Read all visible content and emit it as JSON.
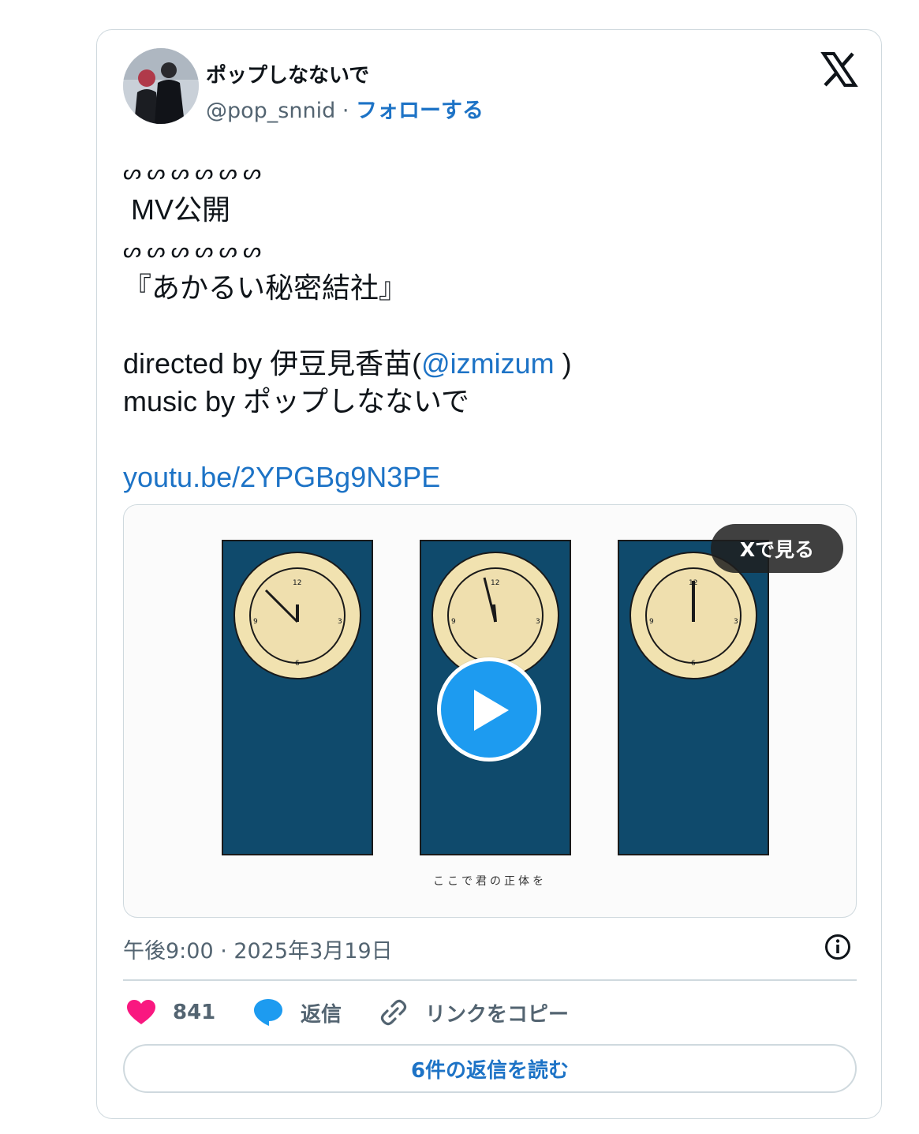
{
  "user": {
    "display_name": "ポップしなないで",
    "handle": "@pop_snnid",
    "separator": "·",
    "follow_label": "フォローする"
  },
  "tweet": {
    "line_deco_1": "ᔕ ᔕ ᔕ ᔕ ᔕ ᔕ",
    "line_mv": " MV公開",
    "line_deco_2": "ᔕ ᔕ ᔕ ᔕ ᔕ ᔕ",
    "line_title": "『あかるい秘密結社』",
    "directed_prefix": "directed by 伊豆見香苗(",
    "director_mention": "@izmizum",
    "directed_suffix": " )",
    "music_line": "music by ポップしなないで",
    "video_link": "youtu.be/2YPGBg9N3PE"
  },
  "media": {
    "watch_on_x": "Xで見る",
    "caption": "ここで君の正体を",
    "clock_numbers": [
      "12",
      "3",
      "6",
      "9"
    ]
  },
  "meta": {
    "timestamp": "午後9:00 · 2025年3月19日"
  },
  "actions": {
    "like_count": "841",
    "reply_label": "返信",
    "copy_link_label": "リンクをコピー",
    "read_replies_label": "6件の返信を読む"
  },
  "colors": {
    "accent": "#1d73c6",
    "play": "#1d9bf0",
    "like": "#f91880",
    "panel": "#0f4a6c",
    "clock_face": "#f1e2b0"
  }
}
